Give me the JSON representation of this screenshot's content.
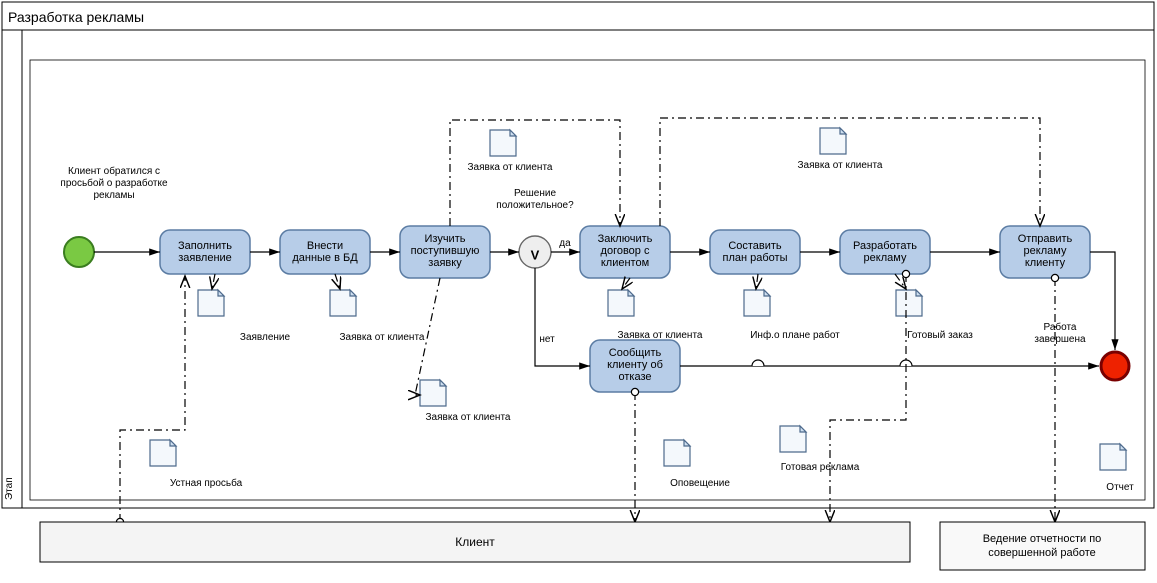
{
  "pool_title": "Разработка рекламы",
  "lane_title": "Этап",
  "start_event_label": "Клиент обратился с просьбой о разработке рекламы",
  "end_event_label": "Работа завершена",
  "gateway": {
    "symbol": "V",
    "label": "Решение положительное?",
    "yes": "да",
    "no": "нет"
  },
  "tasks": {
    "fill_app": {
      "label": "Заполнить заявление"
    },
    "enter_db": {
      "label": "Внести данные в БД"
    },
    "study_req": {
      "l1": "Изучить",
      "l2": "поступившую",
      "l3": "заявку"
    },
    "contract": {
      "l1": "Заключить",
      "l2": "договор с",
      "l3": "клиентом"
    },
    "plan": {
      "l1": "Составить",
      "l2": "план работы"
    },
    "develop": {
      "l1": "Разработать",
      "l2": "рекламу"
    },
    "send": {
      "l1": "Отправить",
      "l2": "рекламу",
      "l3": "клиенту"
    },
    "refuse": {
      "l1": "Сообщить",
      "l2": "клиенту об",
      "l3": "отказе"
    }
  },
  "artifacts": {
    "app_form": "Заявление",
    "req_client": "Заявка от клиента",
    "plan_info": "Инф.о плане работ",
    "ready_order": "Готовый заказ",
    "oral_req": "Устная просьба",
    "notify": "Оповещение",
    "ready_ad": "Готовая реклама",
    "report": "Отчет"
  },
  "participants": {
    "client": "Клиент",
    "reporting": "Ведение отчетности по совершенной работе"
  }
}
